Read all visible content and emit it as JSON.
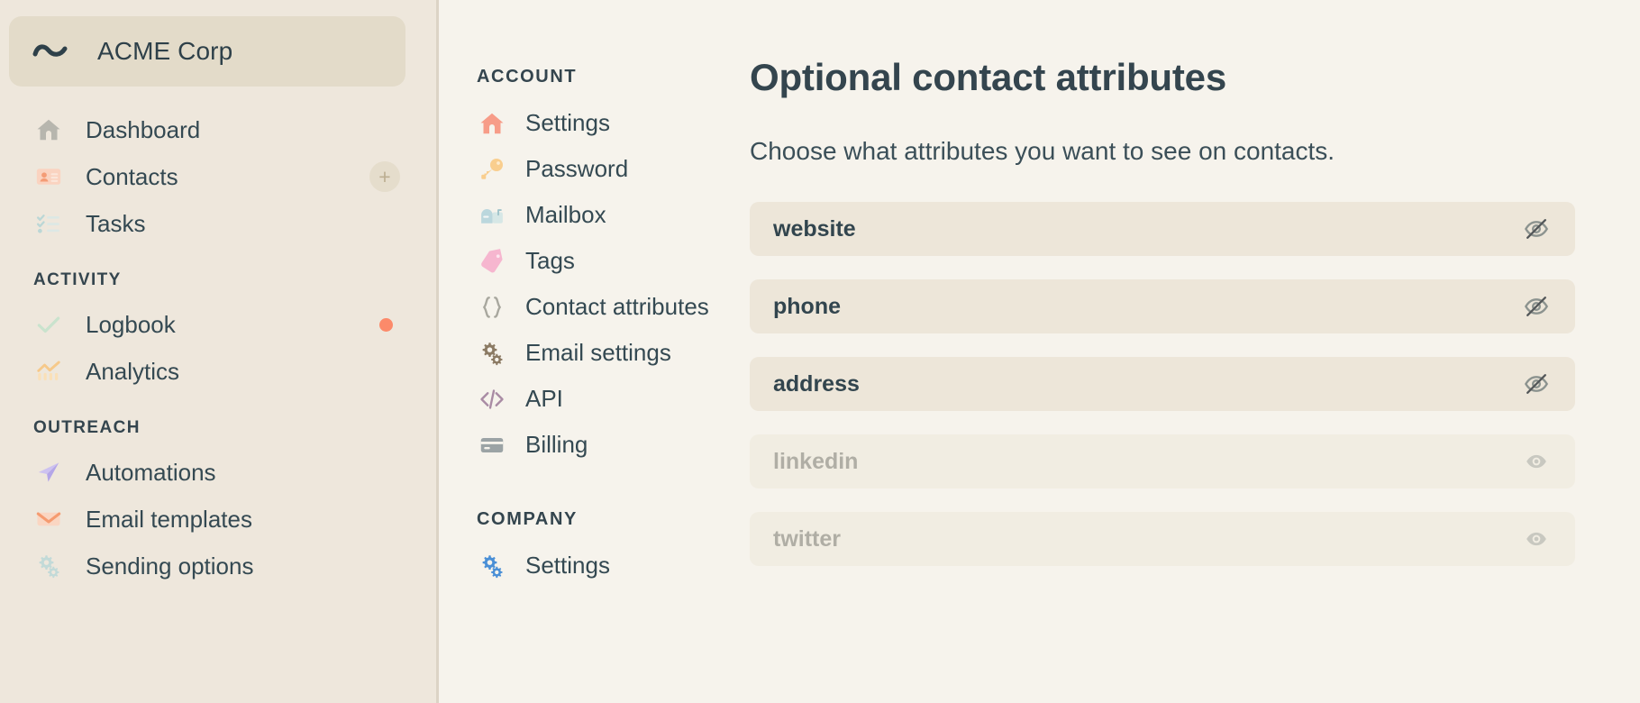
{
  "workspace": {
    "logo_icon": "tilde-logo-icon",
    "name": "ACME Corp"
  },
  "sidebar": {
    "primary_items": [
      {
        "label": "Dashboard",
        "icon": "home-icon"
      },
      {
        "label": "Contacts",
        "icon": "contact-card-icon",
        "action_icon": "plus-icon",
        "action_label": "+"
      },
      {
        "label": "Tasks",
        "icon": "checklist-icon"
      }
    ],
    "sections": [
      {
        "heading": "ACTIVITY",
        "items": [
          {
            "label": "Logbook",
            "icon": "check-icon",
            "badge": true
          },
          {
            "label": "Analytics",
            "icon": "bar-chart-icon"
          }
        ]
      },
      {
        "heading": "OUTREACH",
        "items": [
          {
            "label": "Automations",
            "icon": "paper-plane-icon"
          },
          {
            "label": "Email templates",
            "icon": "envelope-icon"
          },
          {
            "label": "Sending options",
            "icon": "gears-icon"
          }
        ]
      }
    ]
  },
  "settings_nav": {
    "account_heading": "ACCOUNT",
    "account_items": [
      {
        "label": "Settings",
        "icon": "home-icon"
      },
      {
        "label": "Password",
        "icon": "key-icon"
      },
      {
        "label": "Mailbox",
        "icon": "mailbox-icon"
      },
      {
        "label": "Tags",
        "icon": "tag-icon"
      },
      {
        "label": "Contact attributes",
        "icon": "braces-icon"
      },
      {
        "label": "Email settings",
        "icon": "gears-icon"
      },
      {
        "label": "API",
        "icon": "code-icon"
      },
      {
        "label": "Billing",
        "icon": "credit-card-icon"
      }
    ],
    "company_heading": "COMPANY",
    "company_items": [
      {
        "label": "Settings",
        "icon": "gears-icon"
      }
    ]
  },
  "main": {
    "title": "Optional contact attributes",
    "subtitle": "Choose what attributes you want to see on contacts.",
    "attributes": [
      {
        "name": "website",
        "visible": true,
        "toggle_icon": "eye-off-icon"
      },
      {
        "name": "phone",
        "visible": true,
        "toggle_icon": "eye-off-icon"
      },
      {
        "name": "address",
        "visible": true,
        "toggle_icon": "eye-off-icon"
      },
      {
        "name": "linkedin",
        "visible": false,
        "toggle_icon": "eye-icon"
      },
      {
        "name": "twitter",
        "visible": false,
        "toggle_icon": "eye-icon"
      }
    ]
  },
  "colors": {
    "sidebar_bg": "#EEE7DC",
    "main_bg": "#F6F3EC",
    "workspace_bg": "#E3DBC9",
    "text": "#344952",
    "row_active_bg": "#EDE6D9",
    "row_inactive_bg": "#F1EDE2",
    "badge": "#FC8A6A"
  }
}
